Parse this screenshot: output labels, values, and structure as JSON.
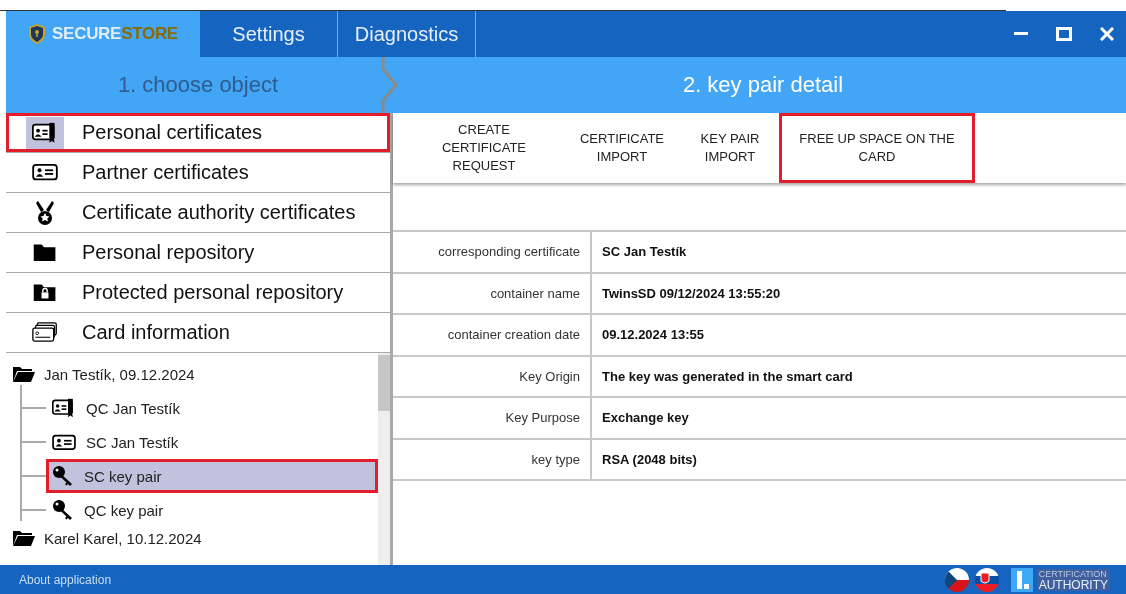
{
  "titlebar": {
    "logo": {
      "parts": [
        "SECURE",
        "STORE"
      ]
    },
    "tabs": [
      {
        "label": "Settings",
        "selected": false
      },
      {
        "label": "Diagnostics",
        "selected": false
      }
    ]
  },
  "steps": [
    {
      "label": "1. choose object",
      "selected": false
    },
    {
      "label": "2. key pair detail",
      "selected": true
    }
  ],
  "menu": [
    {
      "label": "Personal certificates",
      "kind": "qualified-cert",
      "selected": true,
      "annotated": true
    },
    {
      "label": "Partner certificates",
      "kind": "cert",
      "selected": false,
      "annotated": false
    },
    {
      "label": "Certificate authority certificates",
      "kind": "medal",
      "selected": false,
      "annotated": false
    },
    {
      "label": "Personal repository",
      "kind": "folder",
      "selected": false,
      "annotated": false
    },
    {
      "label": "Protected personal repository",
      "kind": "locked-folder",
      "selected": false,
      "annotated": false
    },
    {
      "label": "Card information",
      "kind": "cards",
      "selected": false,
      "annotated": false
    }
  ],
  "tree": [
    {
      "label": "Jan Testík, 09.12.2024",
      "selected": false,
      "children": [
        {
          "label": "QC Jan Testík",
          "kind": "qualified-cert",
          "selected": false,
          "annotated": false
        },
        {
          "label": "SC Jan Testík",
          "kind": "cert",
          "selected": false,
          "annotated": false
        },
        {
          "label": "SC key pair",
          "kind": "key",
          "selected": true,
          "annotated": true
        },
        {
          "label": "QC key pair",
          "kind": "key",
          "selected": false,
          "annotated": false
        }
      ]
    },
    {
      "label": "Karel Karel, 10.12.2024",
      "selected": false
    }
  ],
  "toolbar": [
    {
      "label": "CREATE CERTIFICATE REQUEST",
      "annotated": false
    },
    {
      "label": "CERTIFICATE IMPORT",
      "annotated": false
    },
    {
      "label": "KEY PAIR IMPORT",
      "annotated": false
    },
    {
      "label": "FREE UP SPACE ON THE CARD",
      "annotated": true
    }
  ],
  "details": [
    {
      "label": "corresponding certificate",
      "value": "SC Jan Testík"
    },
    {
      "label": "container name",
      "value": "TwinsSD 09/12/2024 13:55:20"
    },
    {
      "label": "container creation date",
      "value": "09.12.2024 13:55"
    },
    {
      "label": "Key Origin",
      "value": "The key was generated in the smart card"
    },
    {
      "label": "Key Purpose",
      "value": "Exchange key"
    },
    {
      "label": "key type",
      "value": "RSA (2048 bits)"
    }
  ],
  "footer": {
    "link": "About application",
    "authority": [
      "CERTIFICATION",
      "AUTHORITY"
    ]
  }
}
